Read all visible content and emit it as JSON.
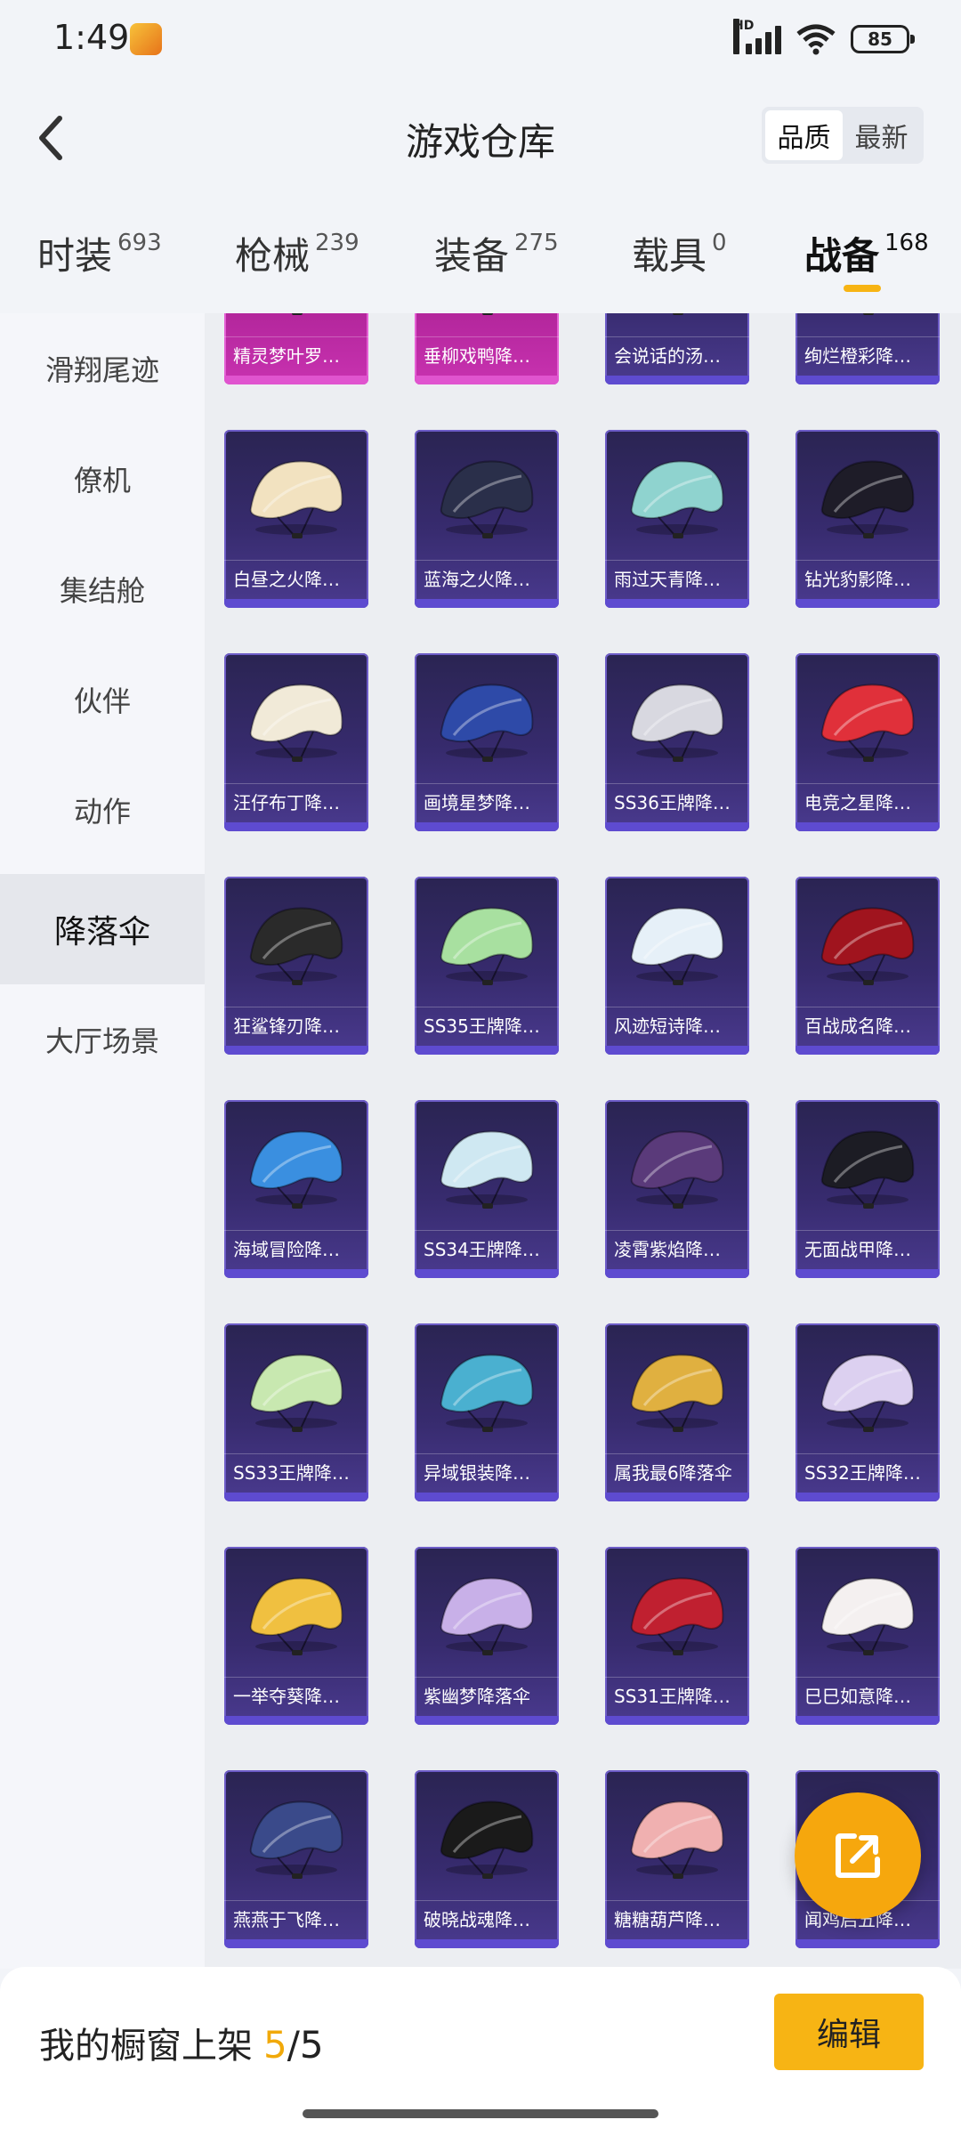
{
  "status_bar": {
    "time": "1:49",
    "network": "HD",
    "battery": "85"
  },
  "header": {
    "title": "游戏仓库",
    "sort_options": [
      {
        "label": "品质",
        "active": true
      },
      {
        "label": "最新",
        "active": false
      }
    ]
  },
  "categories": [
    {
      "name": "时装",
      "count": "693"
    },
    {
      "name": "枪械",
      "count": "239"
    },
    {
      "name": "装备",
      "count": "275"
    },
    {
      "name": "载具",
      "count": "0"
    },
    {
      "name": "战备",
      "count": "168",
      "active": true
    }
  ],
  "sidebar": [
    {
      "label": "滑翔尾迹"
    },
    {
      "label": "僚机"
    },
    {
      "label": "集结舱"
    },
    {
      "label": "伙伴"
    },
    {
      "label": "动作"
    },
    {
      "label": "降落伞",
      "active": true
    },
    {
      "label": "大厅场景"
    }
  ],
  "items": [
    {
      "name": "精灵梦叶罗…",
      "style": "pink"
    },
    {
      "name": "垂柳戏鸭降…",
      "style": "pink"
    },
    {
      "name": "会说话的汤…",
      "style": "purple"
    },
    {
      "name": "绚烂橙彩降…",
      "style": "purple"
    },
    {
      "name": "白昼之火降…",
      "style": "purple"
    },
    {
      "name": "蓝海之火降…",
      "style": "purple"
    },
    {
      "name": "雨过天青降…",
      "style": "purple"
    },
    {
      "name": "钻光豹影降…",
      "style": "purple"
    },
    {
      "name": "汪仔布丁降…",
      "style": "purple"
    },
    {
      "name": "画境星梦降…",
      "style": "purple"
    },
    {
      "name": "SS36王牌降…",
      "style": "purple"
    },
    {
      "name": "电竞之星降…",
      "style": "purple"
    },
    {
      "name": "狂鲨锋刃降…",
      "style": "purple"
    },
    {
      "name": "SS35王牌降…",
      "style": "purple"
    },
    {
      "name": "风迹短诗降…",
      "style": "purple"
    },
    {
      "name": "百战成名降…",
      "style": "purple"
    },
    {
      "name": "海域冒险降…",
      "style": "purple"
    },
    {
      "name": "SS34王牌降…",
      "style": "purple"
    },
    {
      "name": "凌霄紫焰降…",
      "style": "purple"
    },
    {
      "name": "无面战甲降…",
      "style": "purple"
    },
    {
      "name": "SS33王牌降…",
      "style": "purple"
    },
    {
      "name": "异域银装降…",
      "style": "purple"
    },
    {
      "name": "属我最6降落伞",
      "style": "purple"
    },
    {
      "name": "SS32王牌降…",
      "style": "purple"
    },
    {
      "name": "一举夺葵降…",
      "style": "purple"
    },
    {
      "name": "紫幽梦降落伞",
      "style": "purple"
    },
    {
      "name": "SS31王牌降…",
      "style": "purple"
    },
    {
      "name": "巳巳如意降…",
      "style": "purple"
    },
    {
      "name": "燕燕于飞降…",
      "style": "purple"
    },
    {
      "name": "破晓战魂降…",
      "style": "purple"
    },
    {
      "name": "糖糖葫芦降…",
      "style": "purple"
    },
    {
      "name": "闻鸡启五降…",
      "style": "purple"
    }
  ],
  "canopy_colors": [
    "#e9e4f0",
    "#f4c64a",
    "#6b6b58",
    "#d9573a",
    "#f2e2c0",
    "#2a2f4a",
    "#8fd3cf",
    "#1e1c28",
    "#f1ead8",
    "#2e4aa8",
    "#d8d8e0",
    "#e0303a",
    "#2a2a2a",
    "#a8e0a0",
    "#e6f0f8",
    "#a0141e",
    "#3a8fe0",
    "#cfe8f2",
    "#5a3a7a",
    "#1c1c24",
    "#c8e8b0",
    "#4ab0d0",
    "#e0b040",
    "#dcd0f0",
    "#f0c040",
    "#c8b0e8",
    "#c02030",
    "#f4f0f0",
    "#3a4a8a",
    "#1a1a1a",
    "#f0b0b0",
    "#f0c0a0"
  ],
  "share_fab": {
    "icon": "share-icon"
  },
  "bottom_bar": {
    "label": "我的橱窗上架",
    "count": "5",
    "separator": "/",
    "total": "5",
    "edit_label": "编辑"
  }
}
